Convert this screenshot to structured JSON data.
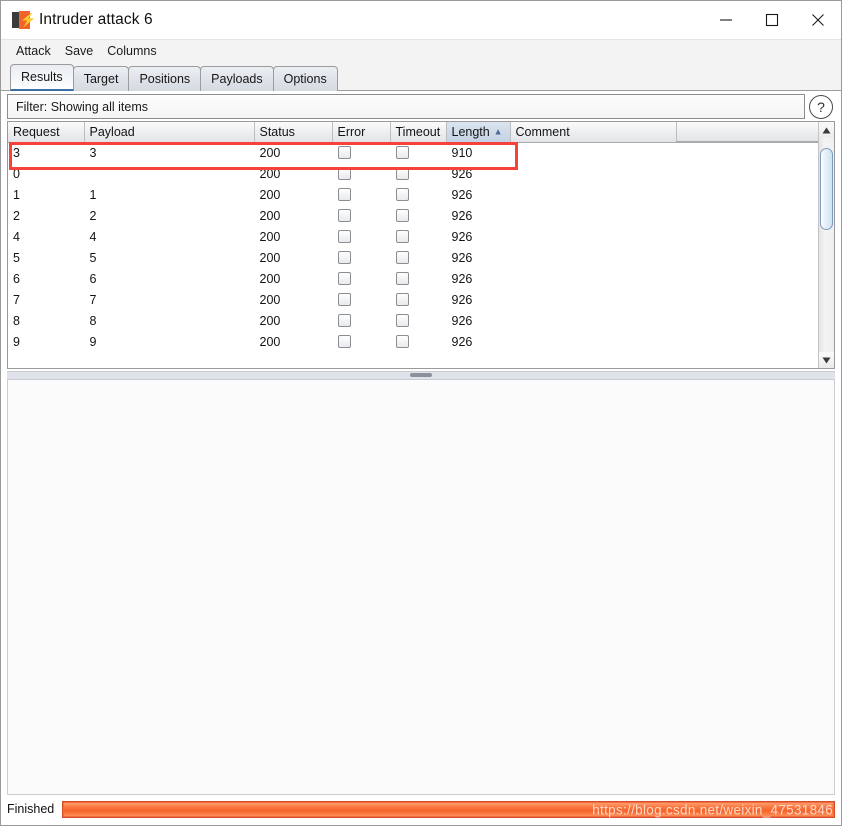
{
  "window": {
    "title": "Intruder attack 6",
    "icon": "burp-suite-icon",
    "controls": {
      "minimize": "minimize-icon",
      "maximize": "maximize-icon",
      "close": "close-icon"
    }
  },
  "menubar": {
    "items": [
      {
        "label": "Attack"
      },
      {
        "label": "Save"
      },
      {
        "label": "Columns"
      }
    ]
  },
  "tabs": [
    {
      "label": "Results",
      "selected": true
    },
    {
      "label": "Target",
      "selected": false
    },
    {
      "label": "Positions",
      "selected": false
    },
    {
      "label": "Payloads",
      "selected": false
    },
    {
      "label": "Options",
      "selected": false
    }
  ],
  "filter": {
    "text": "Filter: Showing all items",
    "help_label": "?"
  },
  "table": {
    "columns": [
      {
        "label": "Request",
        "sorted": false
      },
      {
        "label": "Payload",
        "sorted": false
      },
      {
        "label": "Status",
        "sorted": false
      },
      {
        "label": "Error",
        "sorted": false
      },
      {
        "label": "Timeout",
        "sorted": false
      },
      {
        "label": "Length",
        "sorted": true,
        "sort_direction": "asc",
        "sort_glyph": "▲"
      },
      {
        "label": "Comment",
        "sorted": false
      }
    ],
    "rows": [
      {
        "request": "3",
        "payload": "3",
        "status": "200",
        "error": false,
        "timeout": false,
        "length": "910",
        "comment": "",
        "highlighted": true
      },
      {
        "request": "0",
        "payload": "",
        "status": "200",
        "error": false,
        "timeout": false,
        "length": "926",
        "comment": "",
        "highlighted": false
      },
      {
        "request": "1",
        "payload": "1",
        "status": "200",
        "error": false,
        "timeout": false,
        "length": "926",
        "comment": "",
        "highlighted": false
      },
      {
        "request": "2",
        "payload": "2",
        "status": "200",
        "error": false,
        "timeout": false,
        "length": "926",
        "comment": "",
        "highlighted": false
      },
      {
        "request": "4",
        "payload": "4",
        "status": "200",
        "error": false,
        "timeout": false,
        "length": "926",
        "comment": "",
        "highlighted": false
      },
      {
        "request": "5",
        "payload": "5",
        "status": "200",
        "error": false,
        "timeout": false,
        "length": "926",
        "comment": "",
        "highlighted": false
      },
      {
        "request": "6",
        "payload": "6",
        "status": "200",
        "error": false,
        "timeout": false,
        "length": "926",
        "comment": "",
        "highlighted": false
      },
      {
        "request": "7",
        "payload": "7",
        "status": "200",
        "error": false,
        "timeout": false,
        "length": "926",
        "comment": "",
        "highlighted": false
      },
      {
        "request": "8",
        "payload": "8",
        "status": "200",
        "error": false,
        "timeout": false,
        "length": "926",
        "comment": "",
        "highlighted": false
      },
      {
        "request": "9",
        "payload": "9",
        "status": "200",
        "error": false,
        "timeout": false,
        "length": "926",
        "comment": "",
        "highlighted": false
      }
    ]
  },
  "statusbar": {
    "status": "Finished",
    "progress_percent": 100,
    "watermark": "https://blog.csdn.net/weixin_47531846"
  },
  "colors": {
    "accent_orange": "#f2632a",
    "highlight_red": "#f6423b",
    "tab_selected_underline": "#3d6ea8",
    "sorted_column": "#ccd9e8"
  }
}
